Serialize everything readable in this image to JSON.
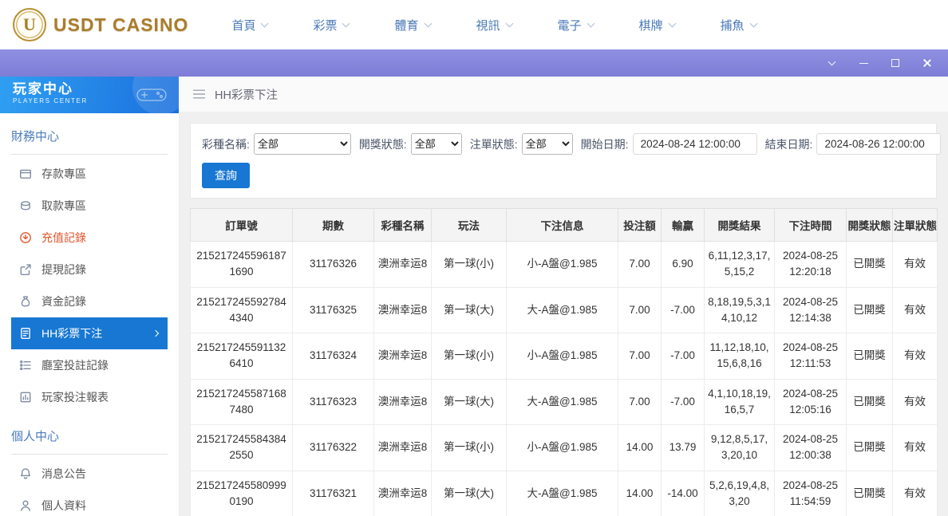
{
  "topnav": {
    "logo_initial": "U",
    "logo_text": "USDT CASINO",
    "items": [
      {
        "name": "home",
        "label": "首頁"
      },
      {
        "name": "lottery",
        "label": "彩票"
      },
      {
        "name": "sports",
        "label": "體育"
      },
      {
        "name": "video",
        "label": "視訊"
      },
      {
        "name": "electronic",
        "label": "電子"
      },
      {
        "name": "boardgames",
        "label": "棋牌"
      },
      {
        "name": "fishing",
        "label": "捕魚"
      }
    ]
  },
  "sidebar": {
    "title": "玩家中心",
    "subtitle": "PLAYERS CENTER",
    "sections": [
      {
        "title": "財務中心",
        "items": [
          {
            "name": "deposit",
            "icon": "deposit-icon",
            "label": "存款專區",
            "state": "normal"
          },
          {
            "name": "withdraw",
            "icon": "withdraw-icon",
            "label": "取款專區",
            "state": "normal"
          },
          {
            "name": "recharge-record",
            "icon": "recharge-icon",
            "label": "充值記錄",
            "state": "highlight"
          },
          {
            "name": "cashout-record",
            "icon": "cashout-icon",
            "label": "提現記錄",
            "state": "normal"
          },
          {
            "name": "funds-record",
            "icon": "funds-icon",
            "label": "資金記錄",
            "state": "normal"
          },
          {
            "name": "hh-lottery-bets",
            "icon": "lottery-doc-icon",
            "label": "HH彩票下注",
            "state": "active"
          },
          {
            "name": "hall-bet-records",
            "icon": "hall-list-icon",
            "label": "廳室投註記錄",
            "state": "normal"
          },
          {
            "name": "player-bet-report",
            "icon": "report-icon",
            "label": "玩家投注報表",
            "state": "normal"
          }
        ]
      },
      {
        "title": "個人中心",
        "items": [
          {
            "name": "announcements",
            "icon": "bell-icon",
            "label": "消息公告",
            "state": "normal"
          },
          {
            "name": "profile",
            "icon": "person-icon",
            "label": "個人資料",
            "state": "normal"
          }
        ]
      }
    ]
  },
  "breadcrumb": {
    "label": "HH彩票下注"
  },
  "filters": {
    "lottery_label": "彩種名稱:",
    "lottery_value": "全部",
    "draw_status_label": "開獎狀態:",
    "draw_status_value": "全部",
    "bet_status_label": "注單狀態:",
    "bet_status_value": "全部",
    "start_label": "開始日期:",
    "start_value": "2024-08-24 12:00:00",
    "end_label": "結束日期:",
    "end_value": "2024-08-26 12:00:00",
    "query_label": "查詢"
  },
  "table": {
    "headers": [
      "訂單號",
      "期數",
      "彩種名稱",
      "玩法",
      "下注信息",
      "投注額",
      "輸贏",
      "開獎結果",
      "下注時間",
      "開獎狀態",
      "注單狀態"
    ],
    "rows": [
      [
        "2152172455961871690",
        "31176326",
        "澳洲幸运8",
        "第一球(小)",
        "小-A盤@1.985",
        "7.00",
        "6.90",
        "6,11,12,3,17,5,15,2",
        "2024-08-25 12:20:18",
        "已開獎",
        "有效"
      ],
      [
        "2152172455927844340",
        "31176325",
        "澳洲幸运8",
        "第一球(大)",
        "大-A盤@1.985",
        "7.00",
        "-7.00",
        "8,18,19,5,3,14,10,12",
        "2024-08-25 12:14:38",
        "已開獎",
        "有效"
      ],
      [
        "2152172455911326410",
        "31176324",
        "澳洲幸运8",
        "第一球(小)",
        "小-A盤@1.985",
        "7.00",
        "-7.00",
        "11,12,18,10,15,6,8,16",
        "2024-08-25 12:11:53",
        "已開獎",
        "有效"
      ],
      [
        "2152172455871687480",
        "31176323",
        "澳洲幸运8",
        "第一球(大)",
        "大-A盤@1.985",
        "7.00",
        "-7.00",
        "4,1,10,18,19,16,5,7",
        "2024-08-25 12:05:16",
        "已開獎",
        "有效"
      ],
      [
        "2152172455843842550",
        "31176322",
        "澳洲幸运8",
        "第一球(小)",
        "小-A盤@1.985",
        "14.00",
        "13.79",
        "9,12,8,5,17,3,20,10",
        "2024-08-25 12:00:38",
        "已開獎",
        "有效"
      ],
      [
        "2152172455809990190",
        "31176321",
        "澳洲幸运8",
        "第一球(大)",
        "大-A盤@1.985",
        "14.00",
        "-14.00",
        "5,2,6,19,4,8,3,20",
        "2024-08-25 11:54:59",
        "已開獎",
        "有效"
      ]
    ]
  },
  "colors": {
    "accent_blue": "#1777d3",
    "highlight_orange": "#e2562b",
    "titlebar_purple": "#8585dc",
    "logo_gold": "#aa7d2c"
  }
}
